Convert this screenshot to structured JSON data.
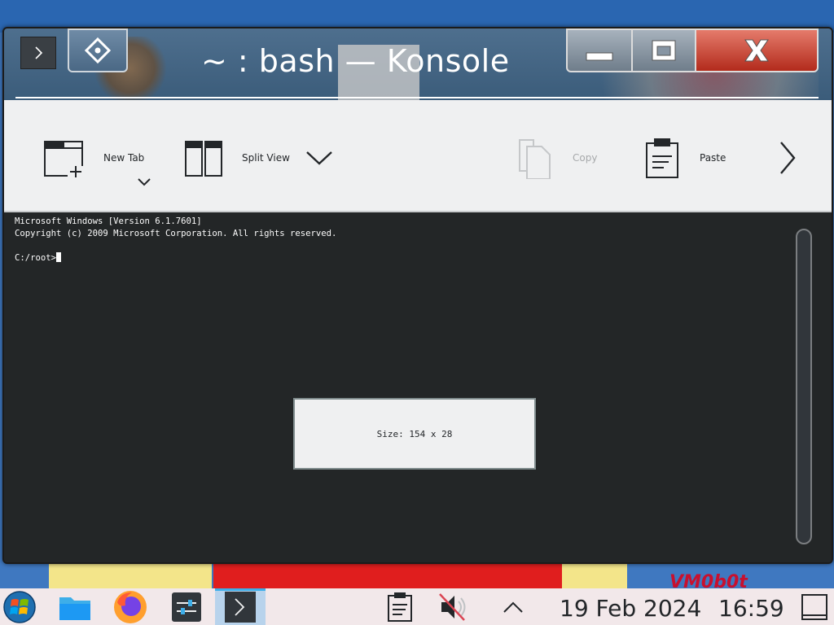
{
  "window": {
    "title": "~ : bash — Konsole"
  },
  "toolbar": {
    "new_tab_label": "New Tab",
    "split_view_label": "Split View",
    "copy_label": "Copy",
    "paste_label": "Paste"
  },
  "terminal": {
    "lines": [
      "Microsoft Windows [Version 6.1.7601]",
      "Copyright (c) 2009 Microsoft Corporation. All rights reserved.",
      "",
      "C:/root>"
    ],
    "size_popup": "Size: 154 x 28"
  },
  "wallpaper": {
    "text": "VM0b0t"
  },
  "taskbar": {
    "date": "19 Feb 2024",
    "time": "16:59",
    "items": [
      "start-menu-icon",
      "file-manager-icon",
      "firefox-icon",
      "settings-icon",
      "konsole-icon"
    ],
    "tray": [
      "clipboard-icon",
      "volume-muted-icon",
      "tray-expand-icon",
      "show-desktop-icon"
    ]
  },
  "colors": {
    "terminal_bg": "#232627",
    "toolbar_bg": "#eff0f1",
    "close_button": "#c0392b",
    "taskbar_bg": "#f2e8ea",
    "active_task": "#b8d3ec"
  }
}
